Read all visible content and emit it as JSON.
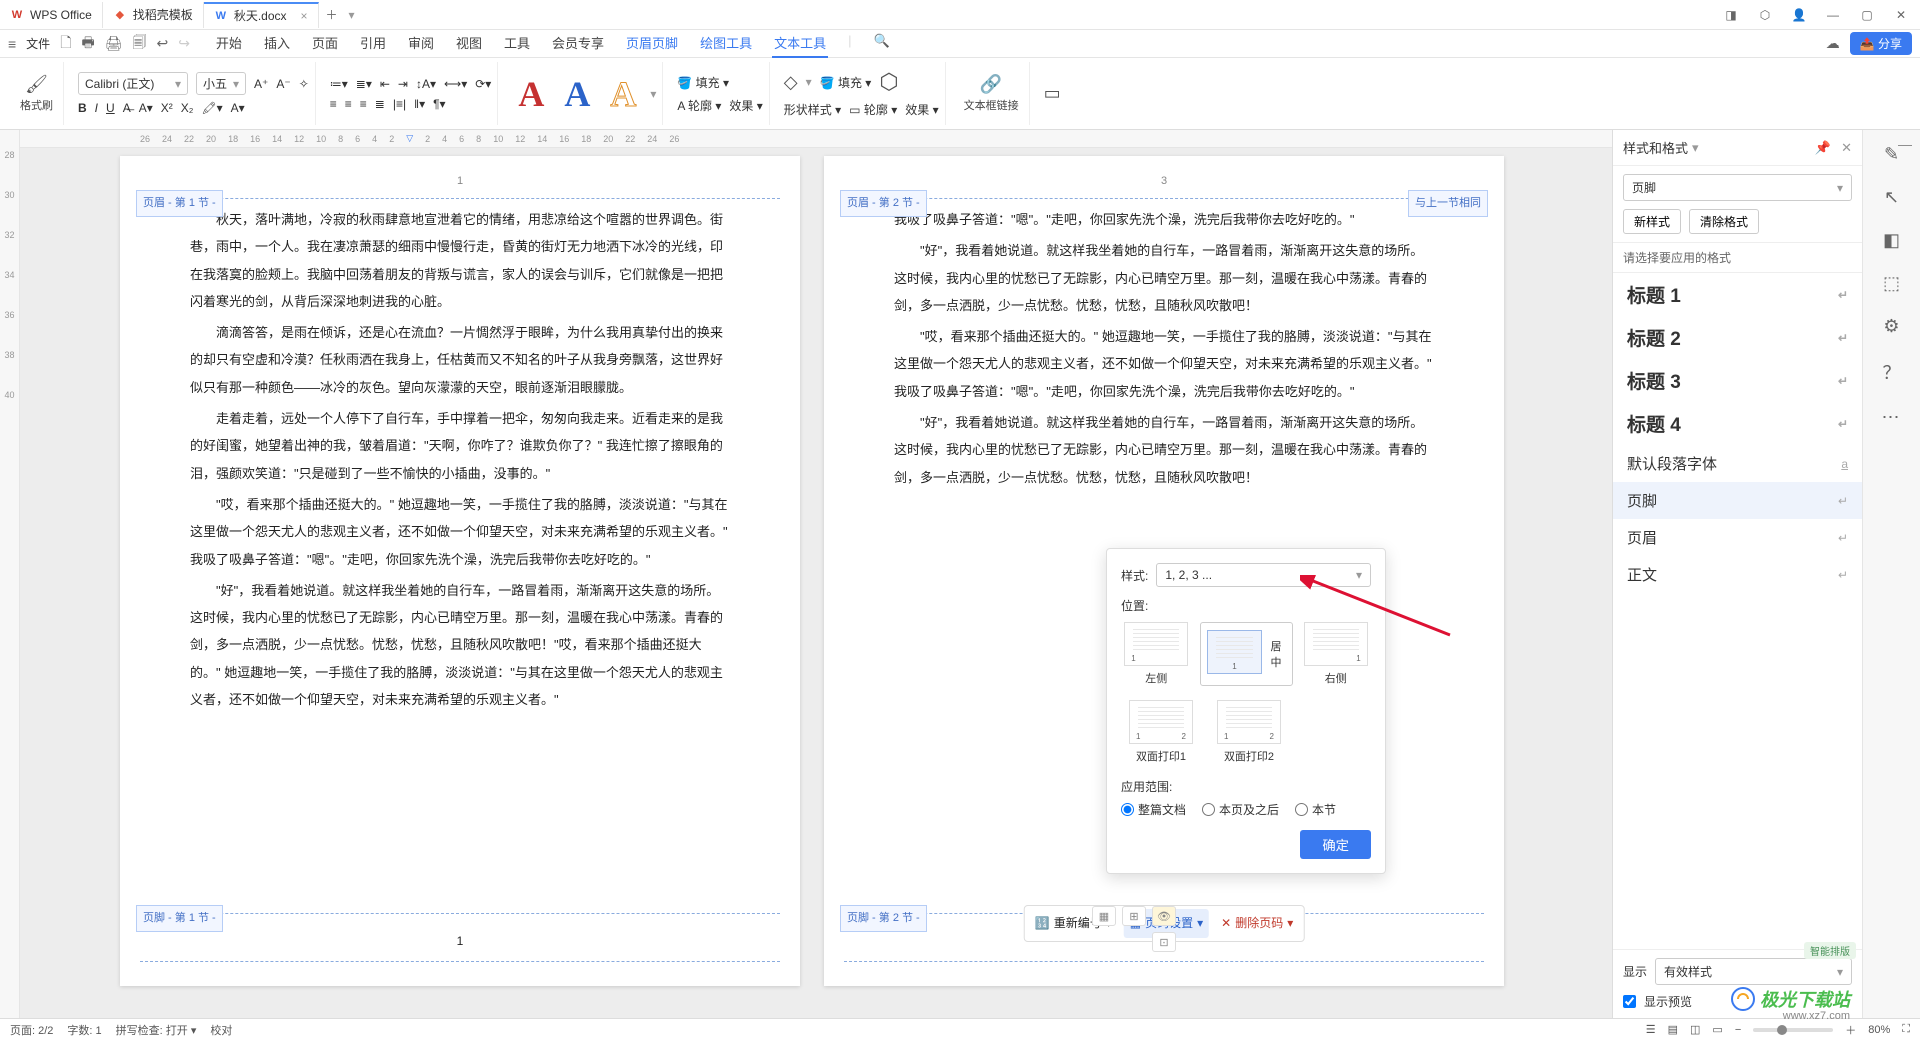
{
  "titlebar": {
    "tabs": [
      {
        "icon": "W",
        "icon_color": "#d23a2e",
        "label": "WPS Office"
      },
      {
        "icon": "◆",
        "icon_color": "#e4573d",
        "label": "找稻壳模板"
      },
      {
        "icon": "W",
        "icon_color": "#3a7af0",
        "label": "秋天.docx",
        "closable": true,
        "active": true
      }
    ],
    "window_controls": [
      "◨",
      "⬡",
      "👤",
      "—",
      "▢",
      "✕"
    ]
  },
  "menubar": {
    "left_icons": [
      "≡",
      "文件",
      "🗋",
      "🖶",
      "🖨",
      "↩",
      "↪"
    ],
    "tabs": [
      "开始",
      "插入",
      "页面",
      "引用",
      "审阅",
      "视图",
      "工具",
      "会员专享",
      "页眉页脚",
      "绘图工具",
      "文本工具"
    ],
    "active_tab": "文本工具",
    "highlight_tab": "页眉页脚",
    "search_icon": "🔍",
    "cloud_icon": "☁",
    "share": "分享"
  },
  "ribbon": {
    "format_painter": "格式刷",
    "font_family": "Calibri (正文)",
    "font_size": "小五",
    "fill": "填充",
    "outline": "轮廓",
    "effect": "效果",
    "shape_style": "形状样式",
    "outline2": "轮廓",
    "effect2": "效果",
    "textbox_link": "文本框链接"
  },
  "hruler": [
    "26",
    "24",
    "22",
    "20",
    "18",
    "16",
    "14",
    "12",
    "10",
    "8",
    "6",
    "4",
    "2",
    "",
    "2",
    "4",
    "6",
    "8",
    "10",
    "12",
    "14",
    "16",
    "18",
    "20",
    "22",
    "24",
    "26"
  ],
  "vruler": [
    "28",
    "30",
    "32",
    "34",
    "36",
    "38",
    "40"
  ],
  "pages": {
    "p1": {
      "num_top": "1",
      "header_label": "页眉 - 第 1 节 -",
      "footer_label": "页脚 - 第 1 节 -",
      "page_num_bottom": "1",
      "paragraphs": [
        "秋天，落叶满地，冷寂的秋雨肆意地宣泄着它的情绪，用悲凉给这个喧嚣的世界调色。街巷，雨中，一个人。我在凄凉萧瑟的细雨中慢慢行走，昏黄的街灯无力地洒下冰冷的光线，印在我落寞的脸颊上。我脑中回荡着朋友的背叛与谎言，家人的误会与训斥，它们就像是一把把闪着寒光的剑，从背后深深地刺进我的心脏。",
        "滴滴答答，是雨在倾诉，还是心在流血？一片惆然浮于眼眸，为什么我用真挚付出的换来的却只有空虚和冷漠？任秋雨洒在我身上，任枯黄而又不知名的叶子从我身旁飘落，这世界好似只有那一种颜色——冰冷的灰色。望向灰濛濛的天空，眼前逐渐泪眼朦胧。",
        "走着走着，远处一个人停下了自行车，手中撑着一把伞，匆匆向我走来。近看走来的是我的好闺蜜，她望着出神的我，皱着眉道：\"天啊，你咋了？谁欺负你了？\" 我连忙擦了擦眼角的泪，强颜欢笑道：\"只是碰到了一些不愉快的小插曲，没事的。\"",
        "\"哎，看来那个插曲还挺大的。\" 她逗趣地一笑，一手揽住了我的胳膊，淡淡说道：\"与其在这里做一个怨天尤人的悲观主义者，还不如做一个仰望天空，对未来充满希望的乐观主义者。\" 我吸了吸鼻子答道：\"嗯\"。\"走吧，你回家先洗个澡，洗完后我带你去吃好吃的。\"",
        "\"好\"，我看着她说道。就这样我坐着她的自行车，一路冒着雨，渐渐离开这失意的场所。这时候，我内心里的忧愁已了无踪影，内心已晴空万里。那一刻，温暖在我心中荡漾。青春的剑，多一点洒脱，少一点忧愁。忧愁，忧愁，且随秋风吹散吧！\"哎，看来那个插曲还挺大的。\" 她逗趣地一笑，一手揽住了我的胳膊，淡淡说道：\"与其在这里做一个怨天尤人的悲观主义者，还不如做一个仰望天空，对未来充满希望的乐观主义者。\""
      ]
    },
    "p2": {
      "num_top": "3",
      "header_label": "页眉 - 第 2 节 -",
      "header_same": "与上一节相同",
      "footer_label": "页脚 - 第 2 节 -",
      "paragraphs": [
        "我吸了吸鼻子答道：\"嗯\"。\"走吧，你回家先洗个澡，洗完后我带你去吃好吃的。\"",
        "\"好\"，我看着她说道。就这样我坐着她的自行车，一路冒着雨，渐渐离开这失意的场所。这时候，我内心里的忧愁已了无踪影，内心已晴空万里。那一刻，温暖在我心中荡漾。青春的剑，多一点洒脱，少一点忧愁。忧愁，忧愁，且随秋风吹散吧！",
        "\"哎，看来那个插曲还挺大的。\" 她逗趣地一笑，一手揽住了我的胳膊，淡淡说道：\"与其在这里做一个怨天尤人的悲观主义者，还不如做一个仰望天空，对未来充满希望的乐观主义者。\" 我吸了吸鼻子答道：\"嗯\"。\"走吧，你回家先洗个澡，洗完后我带你去吃好吃的。\"",
        "\"好\"，我看着她说道。就这样我坐着她的自行车，一路冒着雨，渐渐离开这失意的场所。这时候，我内心里的忧愁已了无踪影，内心已晴空万里。那一刻，温暖在我心中荡漾。青春的剑，多一点洒脱，少一点忧愁。忧愁，忧愁，且随秋风吹散吧！"
      ]
    },
    "toolbar": {
      "renumber": "重新编号",
      "page_setup": "页码设置",
      "delete": "删除页码"
    }
  },
  "popup": {
    "style_label": "样式:",
    "style_value": "1, 2, 3 ...",
    "position_label": "位置:",
    "options": [
      "左侧",
      "居中",
      "右侧",
      "双面打印1",
      "双面打印2"
    ],
    "scope_label": "应用范围:",
    "radios": [
      "整篇文档",
      "本页及之后",
      "本节"
    ],
    "ok": "确定"
  },
  "stylespanel": {
    "title": "样式和格式",
    "current": "页脚",
    "new_style": "新样式",
    "clear": "清除格式",
    "prompt": "请选择要应用的格式",
    "items": [
      {
        "label": "标题 1",
        "h": true
      },
      {
        "label": "标题 2",
        "h": true
      },
      {
        "label": "标题 3",
        "h": true
      },
      {
        "label": "标题 4",
        "h": true
      },
      {
        "label": "默认段落字体"
      },
      {
        "label": "页脚",
        "active": true
      },
      {
        "label": "页眉"
      },
      {
        "label": "正文"
      }
    ],
    "show_label": "显示",
    "show_value": "有效样式",
    "preview": "显示预览",
    "smart_tag": "智能排版"
  },
  "statusbar": {
    "page": "页面: 2/2",
    "words": "字数: 1",
    "spell": "拼写检查: 打开",
    "proof": "校对",
    "zoom": "80%"
  },
  "watermark": {
    "text": "极光下载站",
    "url": "www.xz7.com"
  }
}
